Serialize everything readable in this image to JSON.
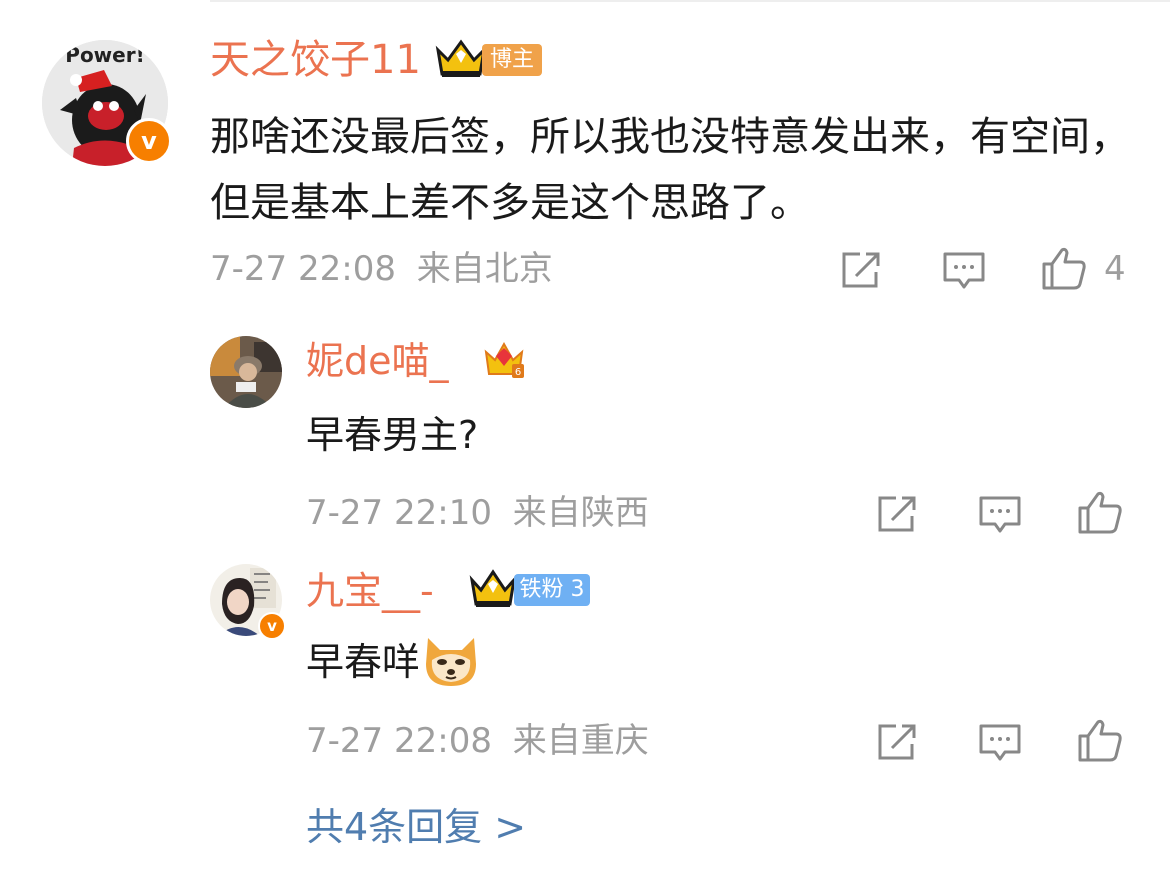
{
  "comment": {
    "username": "天之饺子11",
    "badge": "博主",
    "avatar_text": "Power!",
    "text": "那啥还没最后签，所以我也没特意发出来，有空间，但是基本上差不多是这个思路了。",
    "date": "7-27 22:08",
    "location": "来自北京",
    "like_count": "4"
  },
  "replies": [
    {
      "username": "妮de喵_",
      "badge": "",
      "text": "早春男主?",
      "date": "7-27 22:10",
      "location": "来自陕西"
    },
    {
      "username": "九宝__-",
      "badge": "铁粉 3",
      "text": "早春咩",
      "date": "7-27 22:08",
      "location": "来自重庆"
    }
  ],
  "more_replies": "共4条回复 >",
  "icons": {
    "share": "share-icon",
    "comment": "comment-icon",
    "like": "like-icon",
    "verified": "verified-v-icon",
    "crown": "crown-icon",
    "emoji": "doge-emoji-icon"
  },
  "colors": {
    "username": "#eb7350",
    "meta": "#9e9e9e",
    "link": "#507daf",
    "badge_bg": "#f0a24a",
    "fan_badge_bg": "#6fb0f3",
    "verified": "#f77f00"
  }
}
